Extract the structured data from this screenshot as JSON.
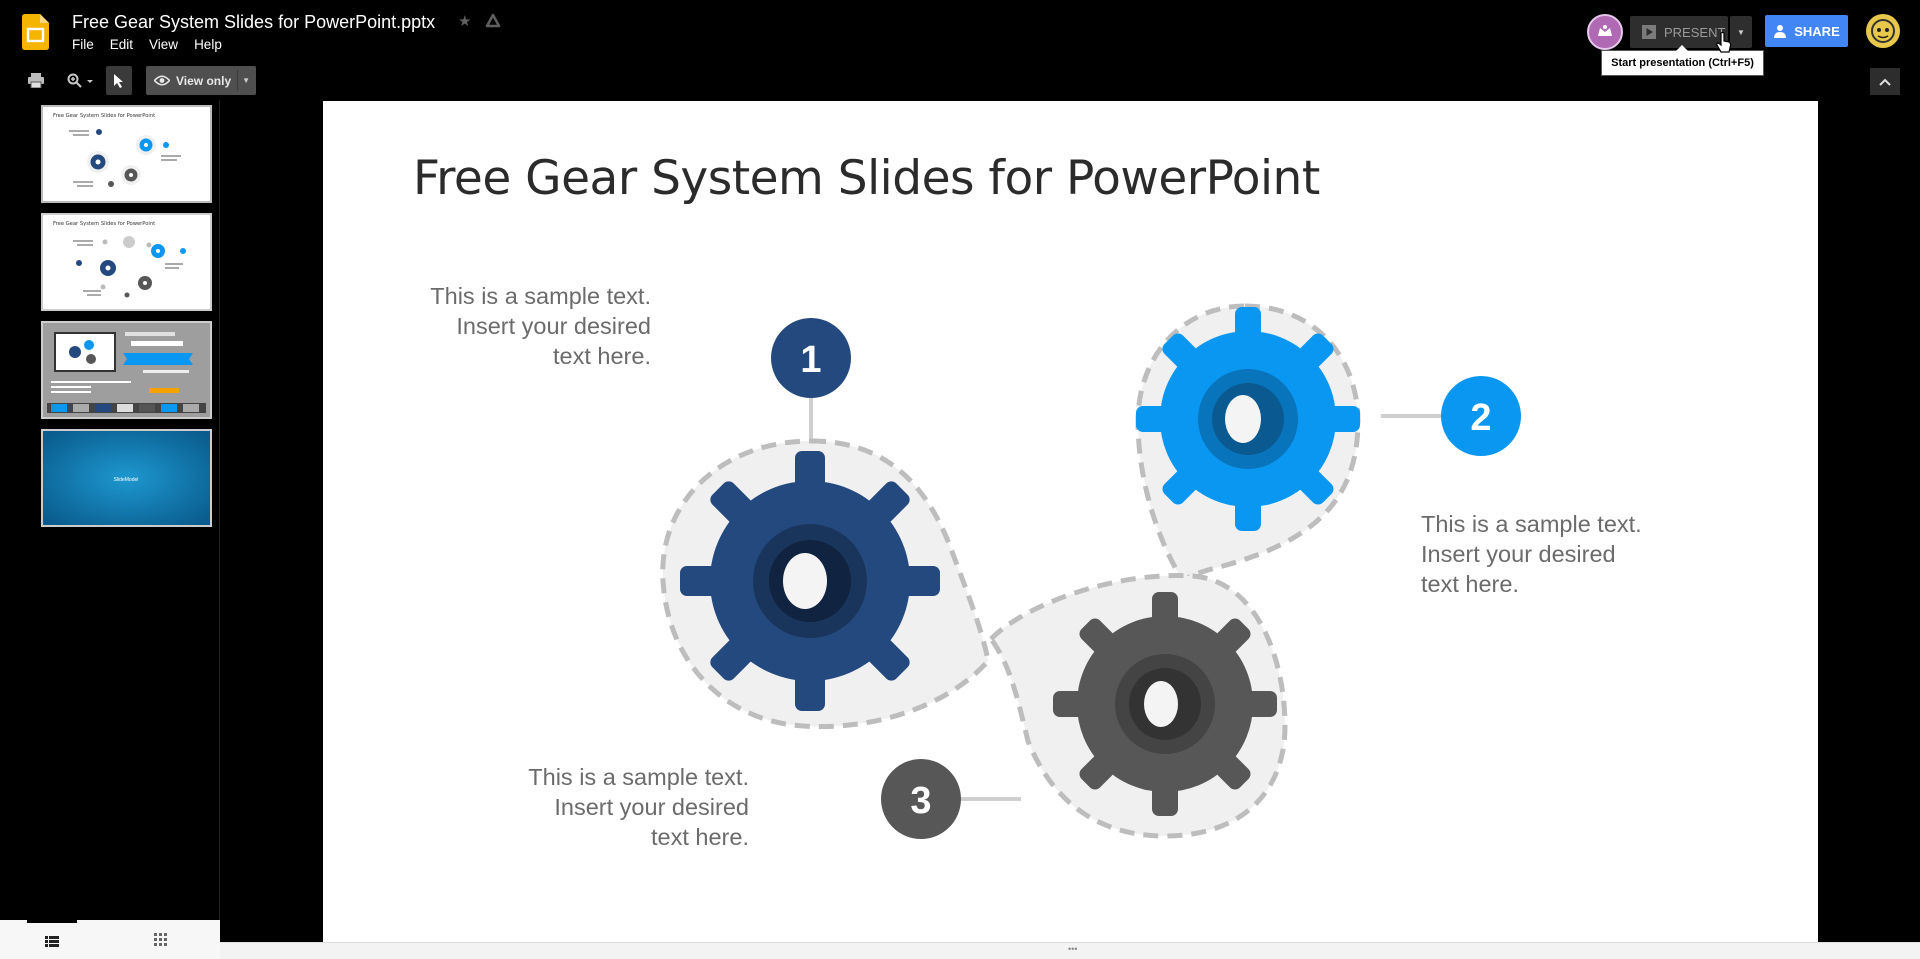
{
  "app": {
    "file_name": "Free Gear System Slides for PowerPoint.pptx",
    "menu": [
      "File",
      "Edit",
      "View",
      "Help"
    ]
  },
  "toolbar": {
    "view_mode_label": "View only"
  },
  "header_right": {
    "present_label": "PRESENT",
    "share_label": "SHARE",
    "tooltip": "Start presentation (Ctrl+F5)"
  },
  "slides": {
    "count": 4,
    "current": 1
  },
  "slide": {
    "title": "Free Gear System Slides for PowerPoint",
    "items": [
      {
        "number": "1",
        "color": "#24497f",
        "lines": [
          "This is a sample text.",
          "Insert your desired",
          "text here."
        ]
      },
      {
        "number": "2",
        "color": "#0a97f2",
        "lines": [
          "This is a sample text.",
          "Insert your desired",
          "text here."
        ]
      },
      {
        "number": "3",
        "color": "#575757",
        "lines": [
          "This is a sample text.",
          "Insert your desired",
          "text here."
        ]
      }
    ]
  },
  "thumbnails": {
    "slide_1_title": "Free Gear System Slides for PowerPoint",
    "slide_2_title": "Free Gear System Slides for PowerPoint",
    "slide_4_logo": "SlideModel"
  },
  "colors": {
    "share_blue": "#4285f4",
    "slides_yellow": "#f4b400",
    "gear_dark_blue": "#24497f",
    "gear_bright_blue": "#0a97f2",
    "gear_gray": "#575757"
  }
}
